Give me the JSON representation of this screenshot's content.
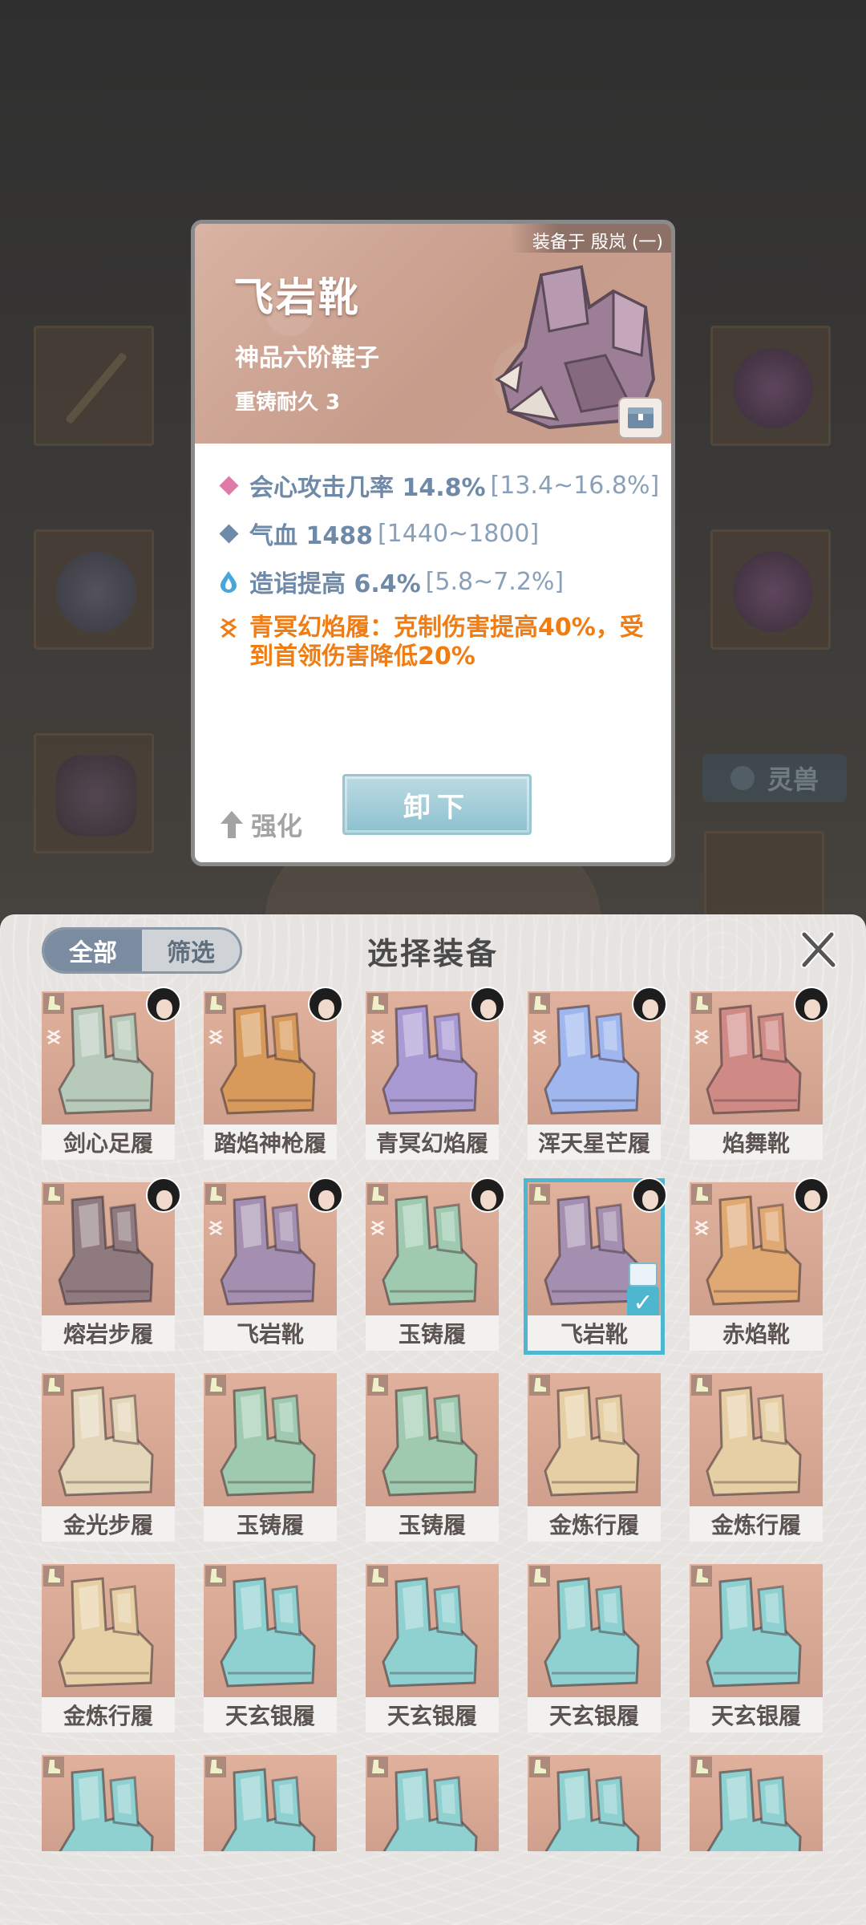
{
  "detail": {
    "equipped_to": "装备于 殷岚 (一)",
    "name": "飞岩靴",
    "grade": "神品六阶鞋子",
    "durability": "重铸耐久 3",
    "stats": [
      {
        "icon": "pink-diamond-icon",
        "color": "#e07aa6",
        "label": "会心攻击几率 14.8%",
        "range": "[13.4~16.8%]"
      },
      {
        "icon": "blue-diamond-icon",
        "color": "#6f8aa8",
        "label": "气血 1488",
        "range": "[1440~1800]"
      },
      {
        "icon": "droplet-icon",
        "color": "#49a6d8",
        "label": "造诣提高 6.4%",
        "range": "[5.8~7.2%]"
      }
    ],
    "set_bonus": "青冥幻焰履：克制伤害提高40%，受到首领伤害降低20%",
    "upgrade_label": "强化",
    "unequip_label": "卸下"
  },
  "background": {
    "pet_tag": "灵兽"
  },
  "panel": {
    "title": "选择装备",
    "filter_all": "全部",
    "filter_screen": "筛选",
    "items": [
      {
        "name": "剑心足履",
        "tone": "#b7c9b8",
        "avatar": true,
        "setmark": true,
        "selected": false
      },
      {
        "name": "踏焰神枪履",
        "tone": "#d89a5a",
        "avatar": true,
        "setmark": true,
        "selected": false
      },
      {
        "name": "青冥幻焰履",
        "tone": "#a99ad3",
        "avatar": true,
        "setmark": true,
        "selected": false
      },
      {
        "name": "浑天星芒履",
        "tone": "#9fb6ee",
        "avatar": true,
        "setmark": true,
        "selected": false
      },
      {
        "name": "焰舞靴",
        "tone": "#d08a86",
        "avatar": true,
        "setmark": true,
        "selected": false
      },
      {
        "name": "熔岩步履",
        "tone": "#8f7a7f",
        "avatar": true,
        "setmark": false,
        "selected": false
      },
      {
        "name": "飞岩靴",
        "tone": "#a48fb0",
        "avatar": true,
        "setmark": true,
        "selected": false
      },
      {
        "name": "玉铸履",
        "tone": "#9fcab0",
        "avatar": true,
        "setmark": true,
        "selected": false
      },
      {
        "name": "飞岩靴",
        "tone": "#a48fb0",
        "avatar": true,
        "setmark": false,
        "selected": true
      },
      {
        "name": "赤焰靴",
        "tone": "#e0a873",
        "avatar": true,
        "setmark": true,
        "selected": false
      },
      {
        "name": "金光步履",
        "tone": "#e4d6b8",
        "avatar": false,
        "setmark": false,
        "selected": false
      },
      {
        "name": "玉铸履",
        "tone": "#9fcab0",
        "avatar": false,
        "setmark": false,
        "selected": false
      },
      {
        "name": "玉铸履",
        "tone": "#9fcab0",
        "avatar": false,
        "setmark": false,
        "selected": false
      },
      {
        "name": "金炼行履",
        "tone": "#e6cfa4",
        "avatar": false,
        "setmark": false,
        "selected": false
      },
      {
        "name": "金炼行履",
        "tone": "#e6cfa4",
        "avatar": false,
        "setmark": false,
        "selected": false
      },
      {
        "name": "金炼行履",
        "tone": "#e6cfa4",
        "avatar": false,
        "setmark": false,
        "selected": false
      },
      {
        "name": "天玄银履",
        "tone": "#8fd0d0",
        "avatar": false,
        "setmark": false,
        "selected": false
      },
      {
        "name": "天玄银履",
        "tone": "#8fd0d0",
        "avatar": false,
        "setmark": false,
        "selected": false
      },
      {
        "name": "天玄银履",
        "tone": "#8fd0d0",
        "avatar": false,
        "setmark": false,
        "selected": false
      },
      {
        "name": "天玄银履",
        "tone": "#8fd0d0",
        "avatar": false,
        "setmark": false,
        "selected": false
      },
      {
        "name": "",
        "tone": "#8fd0d0",
        "avatar": false,
        "setmark": false,
        "selected": false
      },
      {
        "name": "",
        "tone": "#8fd0d0",
        "avatar": false,
        "setmark": false,
        "selected": false
      },
      {
        "name": "",
        "tone": "#8fd0d0",
        "avatar": false,
        "setmark": false,
        "selected": false
      },
      {
        "name": "",
        "tone": "#8fd0d0",
        "avatar": false,
        "setmark": false,
        "selected": false
      },
      {
        "name": "",
        "tone": "#8fd0d0",
        "avatar": false,
        "setmark": false,
        "selected": false
      }
    ]
  },
  "colors": {
    "accent_selected": "#4fb6cf",
    "set_bonus": "#ef7d14",
    "stat_text": "#6f8aa8"
  }
}
